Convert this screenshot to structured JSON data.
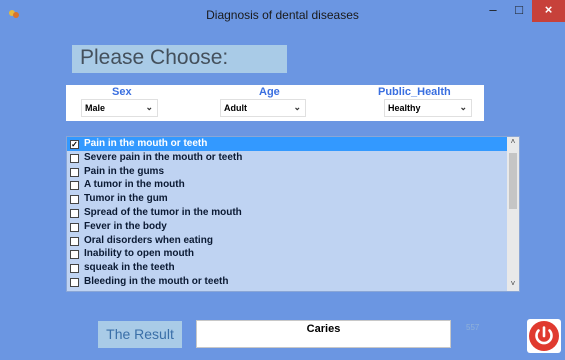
{
  "window": {
    "title": "Diagnosis of dental diseases",
    "min": "–",
    "max": "□",
    "close": "×"
  },
  "header": {
    "please_choose": "Please Choose:"
  },
  "filters": {
    "sex": {
      "label": "Sex",
      "value": "Male"
    },
    "age": {
      "label": "Age",
      "value": "Adult"
    },
    "public_health": {
      "label": "Public_Health",
      "value": "Healthy"
    }
  },
  "symptoms": [
    {
      "label": "Pain in the mouth or teeth",
      "checked": true
    },
    {
      "label": "Severe pain in the mouth or teeth",
      "checked": false
    },
    {
      "label": "Pain in the gums",
      "checked": false
    },
    {
      "label": "A tumor in the mouth",
      "checked": false
    },
    {
      "label": "Tumor in the gum",
      "checked": false
    },
    {
      "label": "Spread of the tumor in the mouth",
      "checked": false
    },
    {
      "label": "Fever in the body",
      "checked": false
    },
    {
      "label": "Oral disorders when eating",
      "checked": false
    },
    {
      "label": "Inability to open mouth",
      "checked": false
    },
    {
      "label": "squeak in the teeth",
      "checked": false
    },
    {
      "label": "Bleeding in the mouth or teeth",
      "checked": false
    }
  ],
  "result": {
    "button_label": "The Result",
    "value": "Caries",
    "code": "557"
  },
  "colors": {
    "background": "#6b96e2",
    "close": "#c7413a",
    "selection": "#3399ff",
    "power": "#e03a2f"
  }
}
